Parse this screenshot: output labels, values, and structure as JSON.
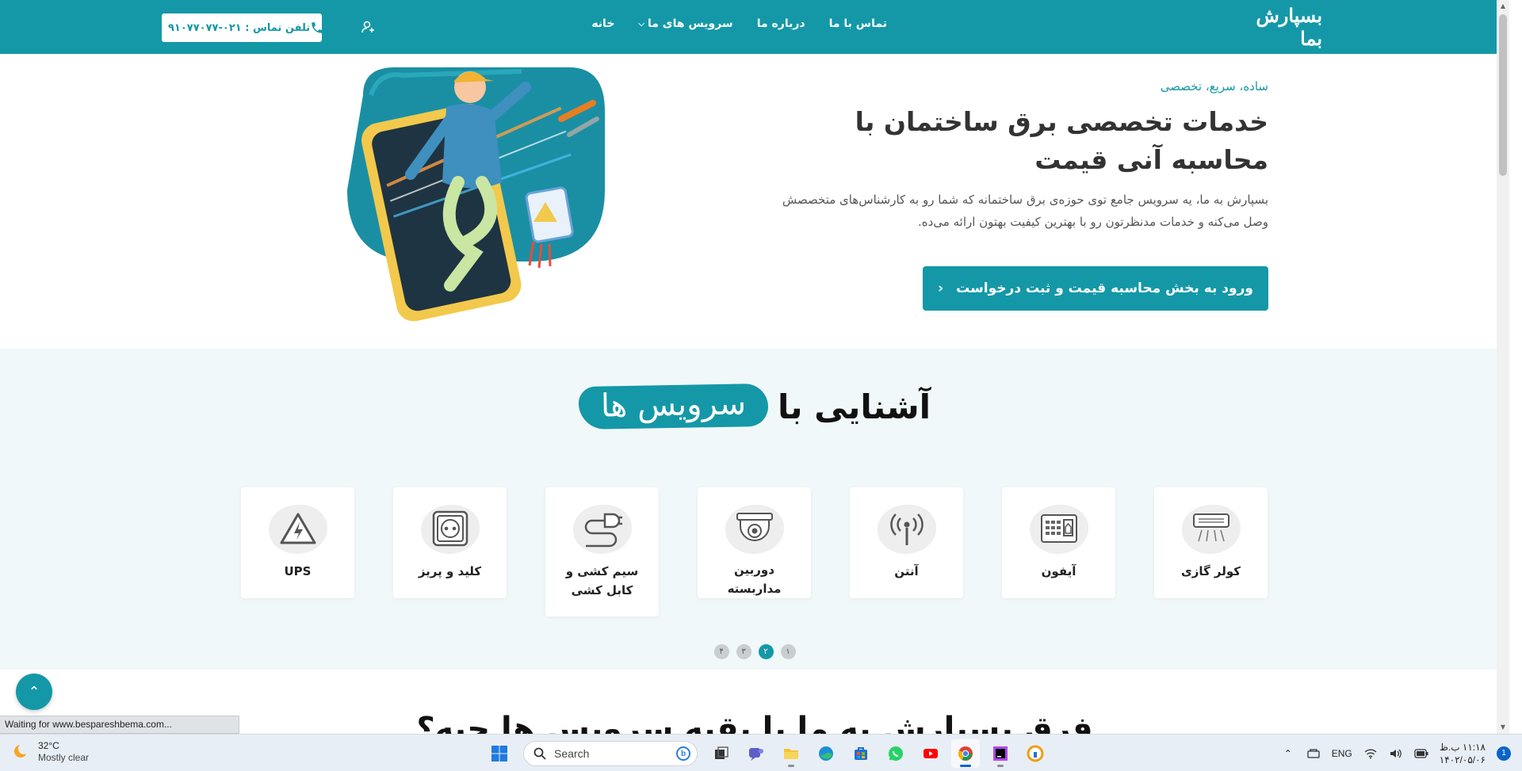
{
  "header": {
    "logo_text": "بسپارش بما",
    "nav": [
      {
        "label": "خانه",
        "has_dropdown": false
      },
      {
        "label": "سرویس های ما",
        "has_dropdown": true
      },
      {
        "label": "درباره ما",
        "has_dropdown": false
      },
      {
        "label": "تماس با ما",
        "has_dropdown": false
      }
    ],
    "user_icon": "user-plus-icon",
    "phone_label": "تلفن تماس : ۰۲۱-۹۱۰۷۷۰۷۷",
    "phone_icon": "phone-icon"
  },
  "hero": {
    "tagline": "ساده، سریع، تخصصی",
    "title": "خدمات تخصصی برق ساختمان با محاسبه آنی قیمت",
    "description": "بسپارش به ما، یه سرویس جامع توی حوزه‌ی برق ساختمانه که شما رو به کارشناس‌های متخصصش وصل می‌کنه و خدمات مدنظرتون رو با بهترین کیفیت بهتون ارائه می‌ده.",
    "cta_label": "ورود به بخش محاسبه قیمت و ثبت درخواست",
    "cta_icon": "chevron-left-icon"
  },
  "services": {
    "title_plain": "آشنایی با",
    "title_highlight": "سرویس ها",
    "items": [
      {
        "label": "کولر گازی",
        "icon": "air-conditioner-icon"
      },
      {
        "label": "آیفون",
        "icon": "intercom-icon"
      },
      {
        "label": "آنتن",
        "icon": "antenna-icon"
      },
      {
        "label": "دوربین مداربسته",
        "icon": "cctv-camera-icon"
      },
      {
        "label": "سیم کشی و کابل کشی",
        "icon": "cable-plug-icon"
      },
      {
        "label": "کلید و پریز",
        "icon": "socket-icon"
      },
      {
        "label": "UPS",
        "icon": "warning-bolt-icon"
      }
    ],
    "pagination": [
      "۱",
      "۲",
      "۳",
      "۴"
    ],
    "active_page": "۲"
  },
  "difference": {
    "title": "فرق بسپارش به ما با بقیه سرویس ها چیه؟"
  },
  "browser": {
    "status_text": "Waiting for www.bespareshbema.com..."
  },
  "taskbar": {
    "weather_temp": "32°C",
    "weather_condition": "Mostly clear",
    "search_placeholder": "Search",
    "apps": [
      "windows-start-icon",
      "task-view-icon",
      "teams-icon",
      "file-explorer-icon",
      "edge-icon",
      "store-icon",
      "whatsapp-icon",
      "youtube-icon",
      "chrome-icon",
      "phpstorm-icon",
      "vpn-icon"
    ],
    "active_app": "chrome-icon",
    "language": "ENG",
    "time": "۱۱:۱۸ ب.ظ",
    "date": "۱۴۰۲/۰۵/۰۶",
    "notification_count": "1"
  },
  "colors": {
    "brand": "#1498a7",
    "services_bg": "#f1f8f9"
  }
}
